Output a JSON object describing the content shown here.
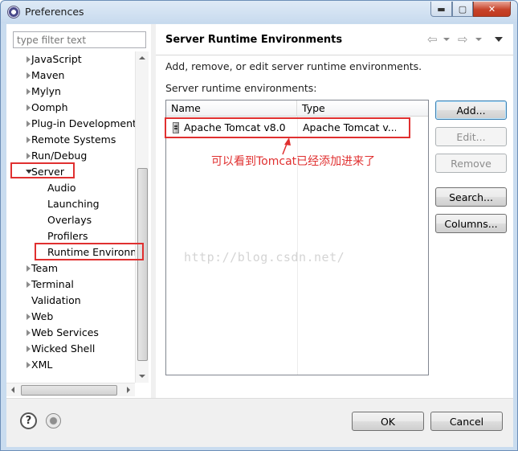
{
  "window": {
    "title": "Preferences",
    "controls": {
      "minimize": "▬",
      "maximize": "▢",
      "close": "✕"
    }
  },
  "sidebar": {
    "filter_placeholder": "type filter text",
    "items": [
      {
        "label": "JavaScript",
        "arrow": "collapsed"
      },
      {
        "label": "Maven",
        "arrow": "collapsed"
      },
      {
        "label": "Mylyn",
        "arrow": "collapsed"
      },
      {
        "label": "Oomph",
        "arrow": "collapsed"
      },
      {
        "label": "Plug-in Development",
        "arrow": "collapsed"
      },
      {
        "label": "Remote Systems",
        "arrow": "collapsed"
      },
      {
        "label": "Run/Debug",
        "arrow": "collapsed"
      },
      {
        "label": "Server",
        "arrow": "expanded"
      },
      {
        "label": "Audio",
        "arrow": "none"
      },
      {
        "label": "Launching",
        "arrow": "none"
      },
      {
        "label": "Overlays",
        "arrow": "none"
      },
      {
        "label": "Profilers",
        "arrow": "none"
      },
      {
        "label": "Runtime Environm",
        "arrow": "none"
      },
      {
        "label": "Team",
        "arrow": "collapsed"
      },
      {
        "label": "Terminal",
        "arrow": "collapsed"
      },
      {
        "label": "Validation",
        "arrow": "none"
      },
      {
        "label": "Web",
        "arrow": "collapsed"
      },
      {
        "label": "Web Services",
        "arrow": "collapsed"
      },
      {
        "label": "Wicked Shell",
        "arrow": "collapsed"
      },
      {
        "label": "XML",
        "arrow": "collapsed"
      }
    ]
  },
  "page": {
    "title": "Server Runtime Environments",
    "description": "Add, remove, or edit server runtime environments.",
    "list_caption": "Server runtime environments:",
    "nav": {
      "back": "⇦",
      "forward": "⇨"
    }
  },
  "table": {
    "columns": [
      "Name",
      "Type"
    ],
    "rows": [
      {
        "name": "Apache Tomcat v8.0",
        "type": "Apache Tomcat v..."
      }
    ],
    "watermark": "http://blog.csdn.net/"
  },
  "buttons": {
    "add": "Add...",
    "edit": "Edit...",
    "remove": "Remove",
    "search": "Search...",
    "columns": "Columns...",
    "ok": "OK",
    "cancel": "Cancel",
    "help": "?"
  },
  "annotation": {
    "text": "可以看到Tomcat已经添加进来了",
    "color": "#e03030"
  },
  "colors": {
    "accent_highlight": "#e03030",
    "titlebar": "#c7daee",
    "close_button": "#c7432a"
  }
}
